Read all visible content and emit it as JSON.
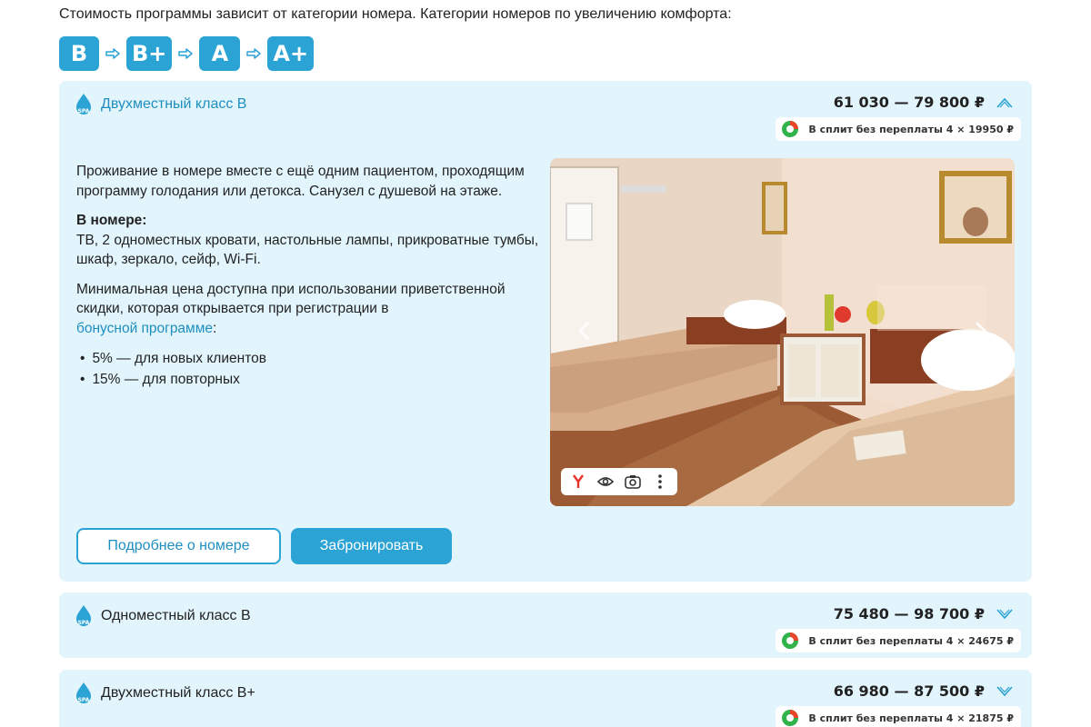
{
  "intro_text": "Стоимость программы зависит от категории номера. Категории номеров по увеличению комфорта:",
  "categories": [
    "B",
    "B+",
    "A",
    "A+"
  ],
  "colors": {
    "accent": "#2ba3d5",
    "card_bg": "#e2f4fc",
    "link": "#1f8fc0"
  },
  "rooms": [
    {
      "title": "Двухместный класс B",
      "price": "61 030 — 79 800 ₽",
      "split": "В сплит без переплаты 4 × 19950 ₽",
      "expanded": true,
      "description": "Проживание в номере вместе с ещё одним пациентом, проходящим программу голодания или детокса. Санузел с душевой на этаже.",
      "amenities_title": "В номере:",
      "amenities": "ТВ, 2 одноместных кровати, настольные лампы, прикроватные тумбы, шкаф, зеркало, сейф, Wi-Fi.",
      "discount_text": "Минимальная цена доступна при использовании приветственной скидки, которая открывается при регистрации в",
      "bonus_link": "бонусной программе",
      "discount_suffix": ":",
      "discounts": [
        "5% — для новых клиентов",
        "15% — для повторных"
      ],
      "more_button": "Подробнее о номере",
      "book_button": "Забронировать"
    },
    {
      "title": "Одноместный класс B",
      "price": "75 480 — 98 700 ₽",
      "split": "В сплит без переплаты 4 × 24675 ₽",
      "expanded": false
    },
    {
      "title": "Двухместный класс B+",
      "price": "66 980 — 87 500 ₽",
      "split": "В сплит без переплаты 4 × 21875 ₽",
      "expanded": false
    }
  ],
  "icons": {
    "spa": "spa-drop-icon",
    "chevron_up": "chevron-up-icon",
    "chevron_down": "chevron-down-icon",
    "split_logo": "split-logo-icon",
    "arrow": "arrow-right-icon",
    "yandex": "yandex-icon",
    "eye": "eye-icon",
    "camera": "camera-search-icon",
    "more": "more-vertical-icon"
  }
}
